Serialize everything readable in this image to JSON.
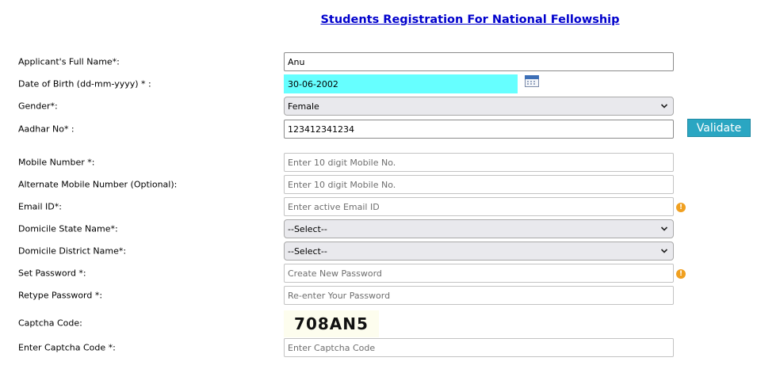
{
  "page": {
    "title": "Students Registration For National Fellowship"
  },
  "form": {
    "full_name": {
      "label": "Applicant's Full Name*:",
      "value": "Anu"
    },
    "dob": {
      "label": "Date of Birth (dd-mm-yyyy) * :",
      "value": "30-06-2002"
    },
    "gender": {
      "label": "Gender*:",
      "value": "Female"
    },
    "aadhar": {
      "label": "Aadhar No* :",
      "value": "123412341234",
      "validate_label": "Validate"
    },
    "mobile": {
      "label": "Mobile Number *:",
      "placeholder": "Enter 10 digit Mobile No."
    },
    "alt_mobile": {
      "label": "Alternate Mobile Number (Optional):",
      "placeholder": "Enter 10 digit Mobile No."
    },
    "email": {
      "label": "Email ID*:",
      "placeholder": "Enter active Email ID"
    },
    "domicile_state": {
      "label": "Domicile State Name*:",
      "value": "--Select--"
    },
    "domicile_district": {
      "label": "Domicile District Name*:",
      "value": "--Select--"
    },
    "password": {
      "label": "Set Password *:",
      "placeholder": "Create New Password"
    },
    "retype_password": {
      "label": "Retype Password *:",
      "placeholder": "Re-enter Your Password"
    },
    "captcha": {
      "label": "Captcha Code:",
      "code": "708AN5"
    },
    "captcha_input": {
      "label": "Enter Captcha Code *:",
      "placeholder": "Enter Captcha Code"
    }
  },
  "icons": {
    "calendar": "calendar-icon",
    "info": "info-icon",
    "info_glyph": "!"
  },
  "colors": {
    "title": "#0000cc",
    "dob_highlight": "#66ffff",
    "validate_button": "#2aa6c2",
    "info_icon": "#f0a020"
  }
}
